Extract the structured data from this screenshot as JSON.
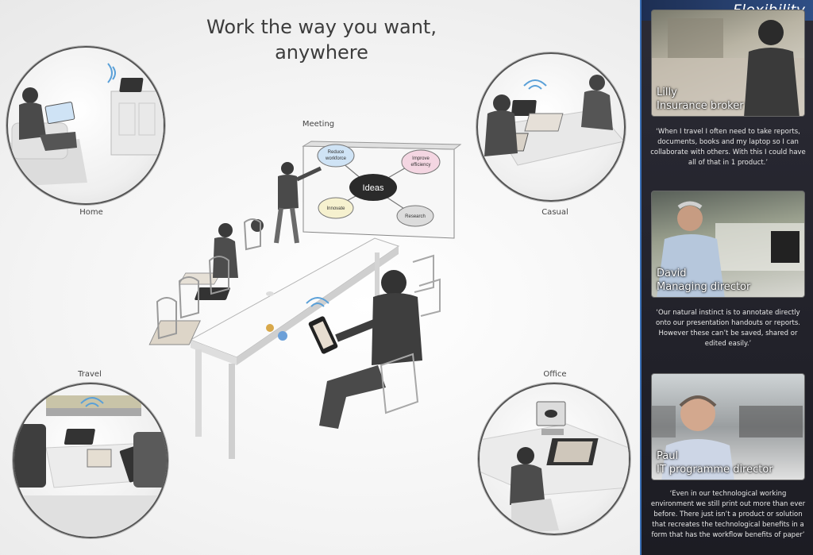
{
  "headline": {
    "line1": "Work the way you want,",
    "line2": "anywhere"
  },
  "places": {
    "meeting": "Meeting",
    "home": "Home",
    "casual": "Casual",
    "travel": "Travel",
    "office": "Office"
  },
  "whiteboard": {
    "center": "Ideas",
    "node1_line1": "Reduce",
    "node1_line2": "workforce",
    "node2_line1": "Improve",
    "node2_line2": "efficiency",
    "node3": "Innovate",
    "node4": "Research"
  },
  "sidebar": {
    "title": "Flexibility",
    "people": [
      {
        "name": "Lilly",
        "role": "Insurance broker",
        "quote": "‘When I travel I often need to take reports, documents, books and my laptop so I can collaborate with others. With this I could have all of that in 1 product.’"
      },
      {
        "name": "David",
        "role": "Managing director",
        "quote": "‘Our natural instinct is to annotate directly onto our presentation handouts or reports. However these can’t be saved, shared or edited easily.’"
      },
      {
        "name": "Paul",
        "role": "IT programme director",
        "quote": "‘Even in our technological working environment we still print out more than ever before. There just isn’t a product or solution that recreates the technological benefits in a form that has the workflow benefits of paper’"
      }
    ]
  },
  "colors": {
    "sidebar_bg": "#23232b",
    "title_bar": "#2f4f86",
    "wifi": "#5aa0d8",
    "bubble_blue": "#cfe3f5",
    "bubble_pink": "#f4d6e2",
    "bubble_yellow": "#f6f1cf",
    "bubble_grey": "#dcdcdc"
  }
}
